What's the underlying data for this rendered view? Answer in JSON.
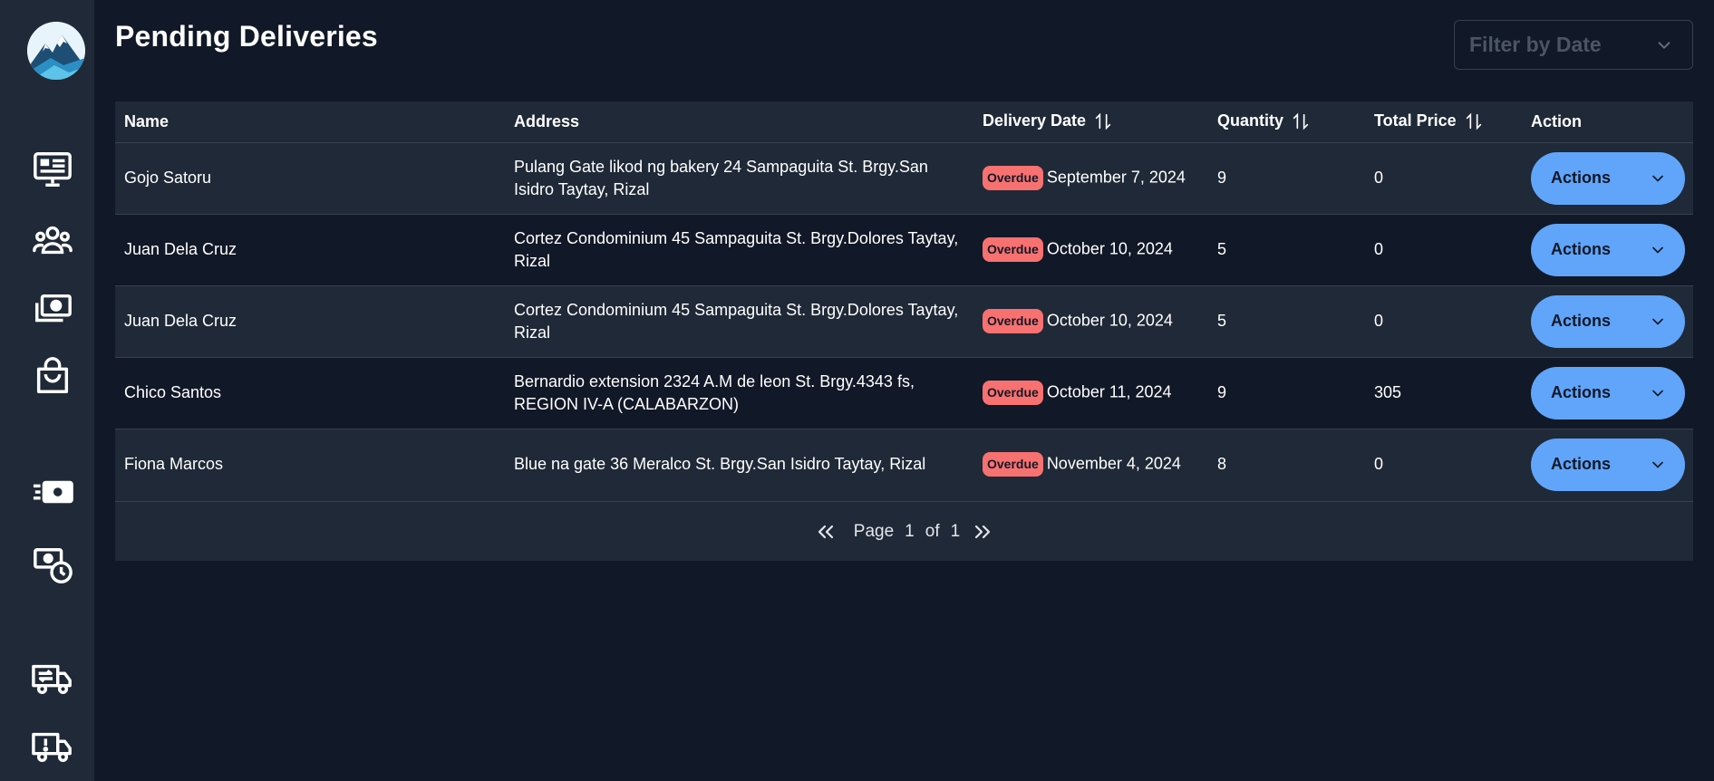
{
  "page": {
    "title": "Pending Deliveries"
  },
  "filter": {
    "label": "Filter by Date"
  },
  "table": {
    "headers": {
      "name": "Name",
      "address": "Address",
      "delivery_date": "Delivery Date",
      "quantity": "Quantity",
      "total_price": "Total Price",
      "action": "Action"
    },
    "rows": [
      {
        "name": "Gojo Satoru",
        "address": "Pulang Gate likod ng bakery 24 Sampaguita St. Brgy.San Isidro Taytay, Rizal",
        "status": "Overdue",
        "date": "September 7, 2024",
        "quantity": "9",
        "total_price": "0",
        "action": "Actions"
      },
      {
        "name": "Juan Dela Cruz",
        "address": "Cortez Condominium 45 Sampaguita St. Brgy.Dolores Taytay, Rizal",
        "status": "Overdue",
        "date": "October 10, 2024",
        "quantity": "5",
        "total_price": "0",
        "action": "Actions"
      },
      {
        "name": "Juan Dela Cruz",
        "address": "Cortez Condominium 45 Sampaguita St. Brgy.Dolores Taytay, Rizal",
        "status": "Overdue",
        "date": "October 10, 2024",
        "quantity": "5",
        "total_price": "0",
        "action": "Actions"
      },
      {
        "name": "Chico Santos",
        "address": "Bernardio extension 2324 A.M de leon St. Brgy.4343 fs, REGION IV-A (CALABARZON)",
        "status": "Overdue",
        "date": "October 11, 2024",
        "quantity": "9",
        "total_price": "305",
        "action": "Actions"
      },
      {
        "name": "Fiona Marcos",
        "address": "Blue na gate 36 Meralco St. Brgy.San Isidro Taytay, Rizal",
        "status": "Overdue",
        "date": "November 4, 2024",
        "quantity": "8",
        "total_price": "0",
        "action": "Actions"
      }
    ]
  },
  "pagination": {
    "page_label": "Page",
    "current": "1",
    "of_label": "of",
    "total": "1"
  },
  "sidebar": {
    "icons": [
      "dashboard-icon",
      "users-icon",
      "cash-icon",
      "shopping-bag-icon",
      "fast-cash-icon",
      "cash-clock-icon",
      "truck-transfer-icon",
      "truck-alert-icon"
    ]
  },
  "colors": {
    "background": "#111827",
    "panel": "#1f2937",
    "accent": "#60a5fa",
    "overdue": "#f87171"
  }
}
